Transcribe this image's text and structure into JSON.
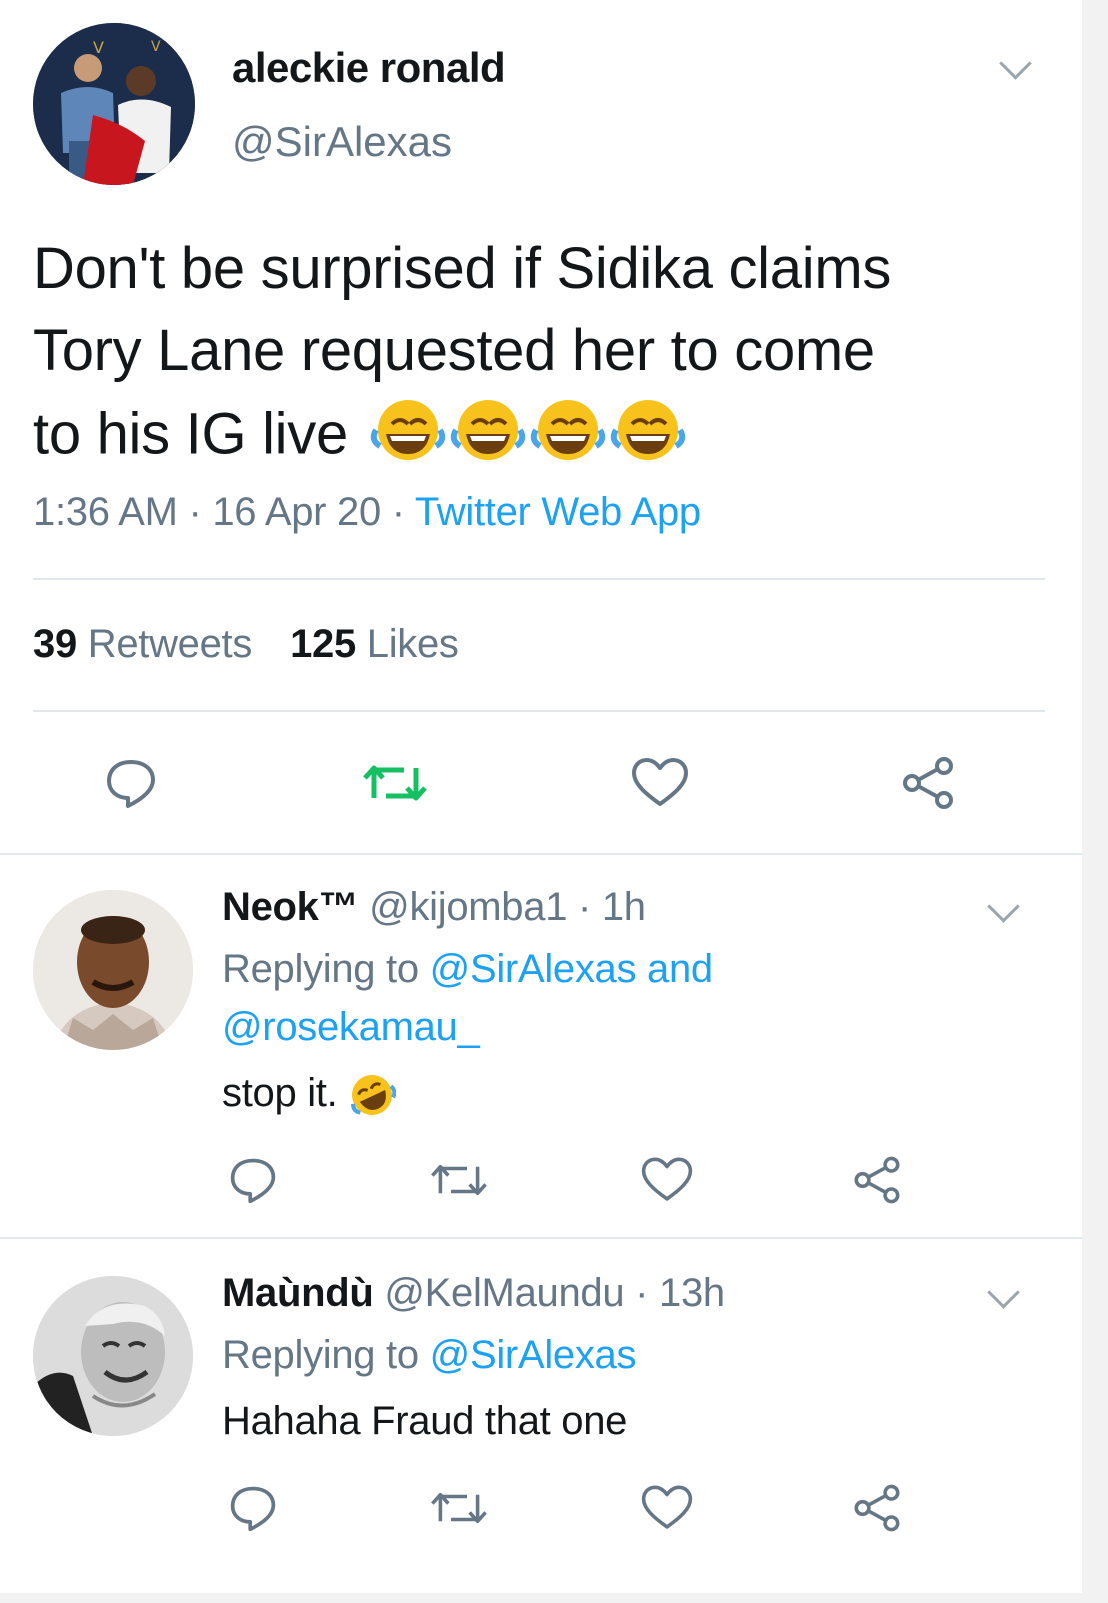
{
  "main_tweet": {
    "author_name": "aleckie ronald",
    "author_handle": "@SirAlexas",
    "text_lines": [
      "Don't be surprised if Sidika claims",
      "Tory Lane requested her to come",
      "to his IG live"
    ],
    "emoji": "😂😂😂😂",
    "time": "1:36 AM",
    "date": "16 Apr 20",
    "source": "Twitter Web App",
    "retweets_count": "39",
    "retweets_label": "Retweets",
    "likes_count": "125",
    "likes_label": "Likes",
    "actions": [
      "reply-icon",
      "retweet-icon",
      "like-icon",
      "share-icon"
    ]
  },
  "replies": [
    {
      "name": "Neok™",
      "handle": "@kijomba1",
      "age": "1h",
      "replying_label": "Replying to",
      "replying_to_line1": "@SirAlexas and",
      "replying_to_line2": "@rosekamau_",
      "text": "stop it.",
      "emoji": "🤣"
    },
    {
      "name": "Maùndù",
      "handle": "@KelMaundu",
      "age": "13h",
      "replying_label": "Replying to",
      "replying_to_line1": "@SirAlexas",
      "text": "Hahaha Fraud that one"
    }
  ],
  "colors": {
    "text": "#14171a",
    "secondary": "#657786",
    "link": "#1da1f2",
    "retweet_active": "#17bf63",
    "divider": "#e1e8ed"
  }
}
